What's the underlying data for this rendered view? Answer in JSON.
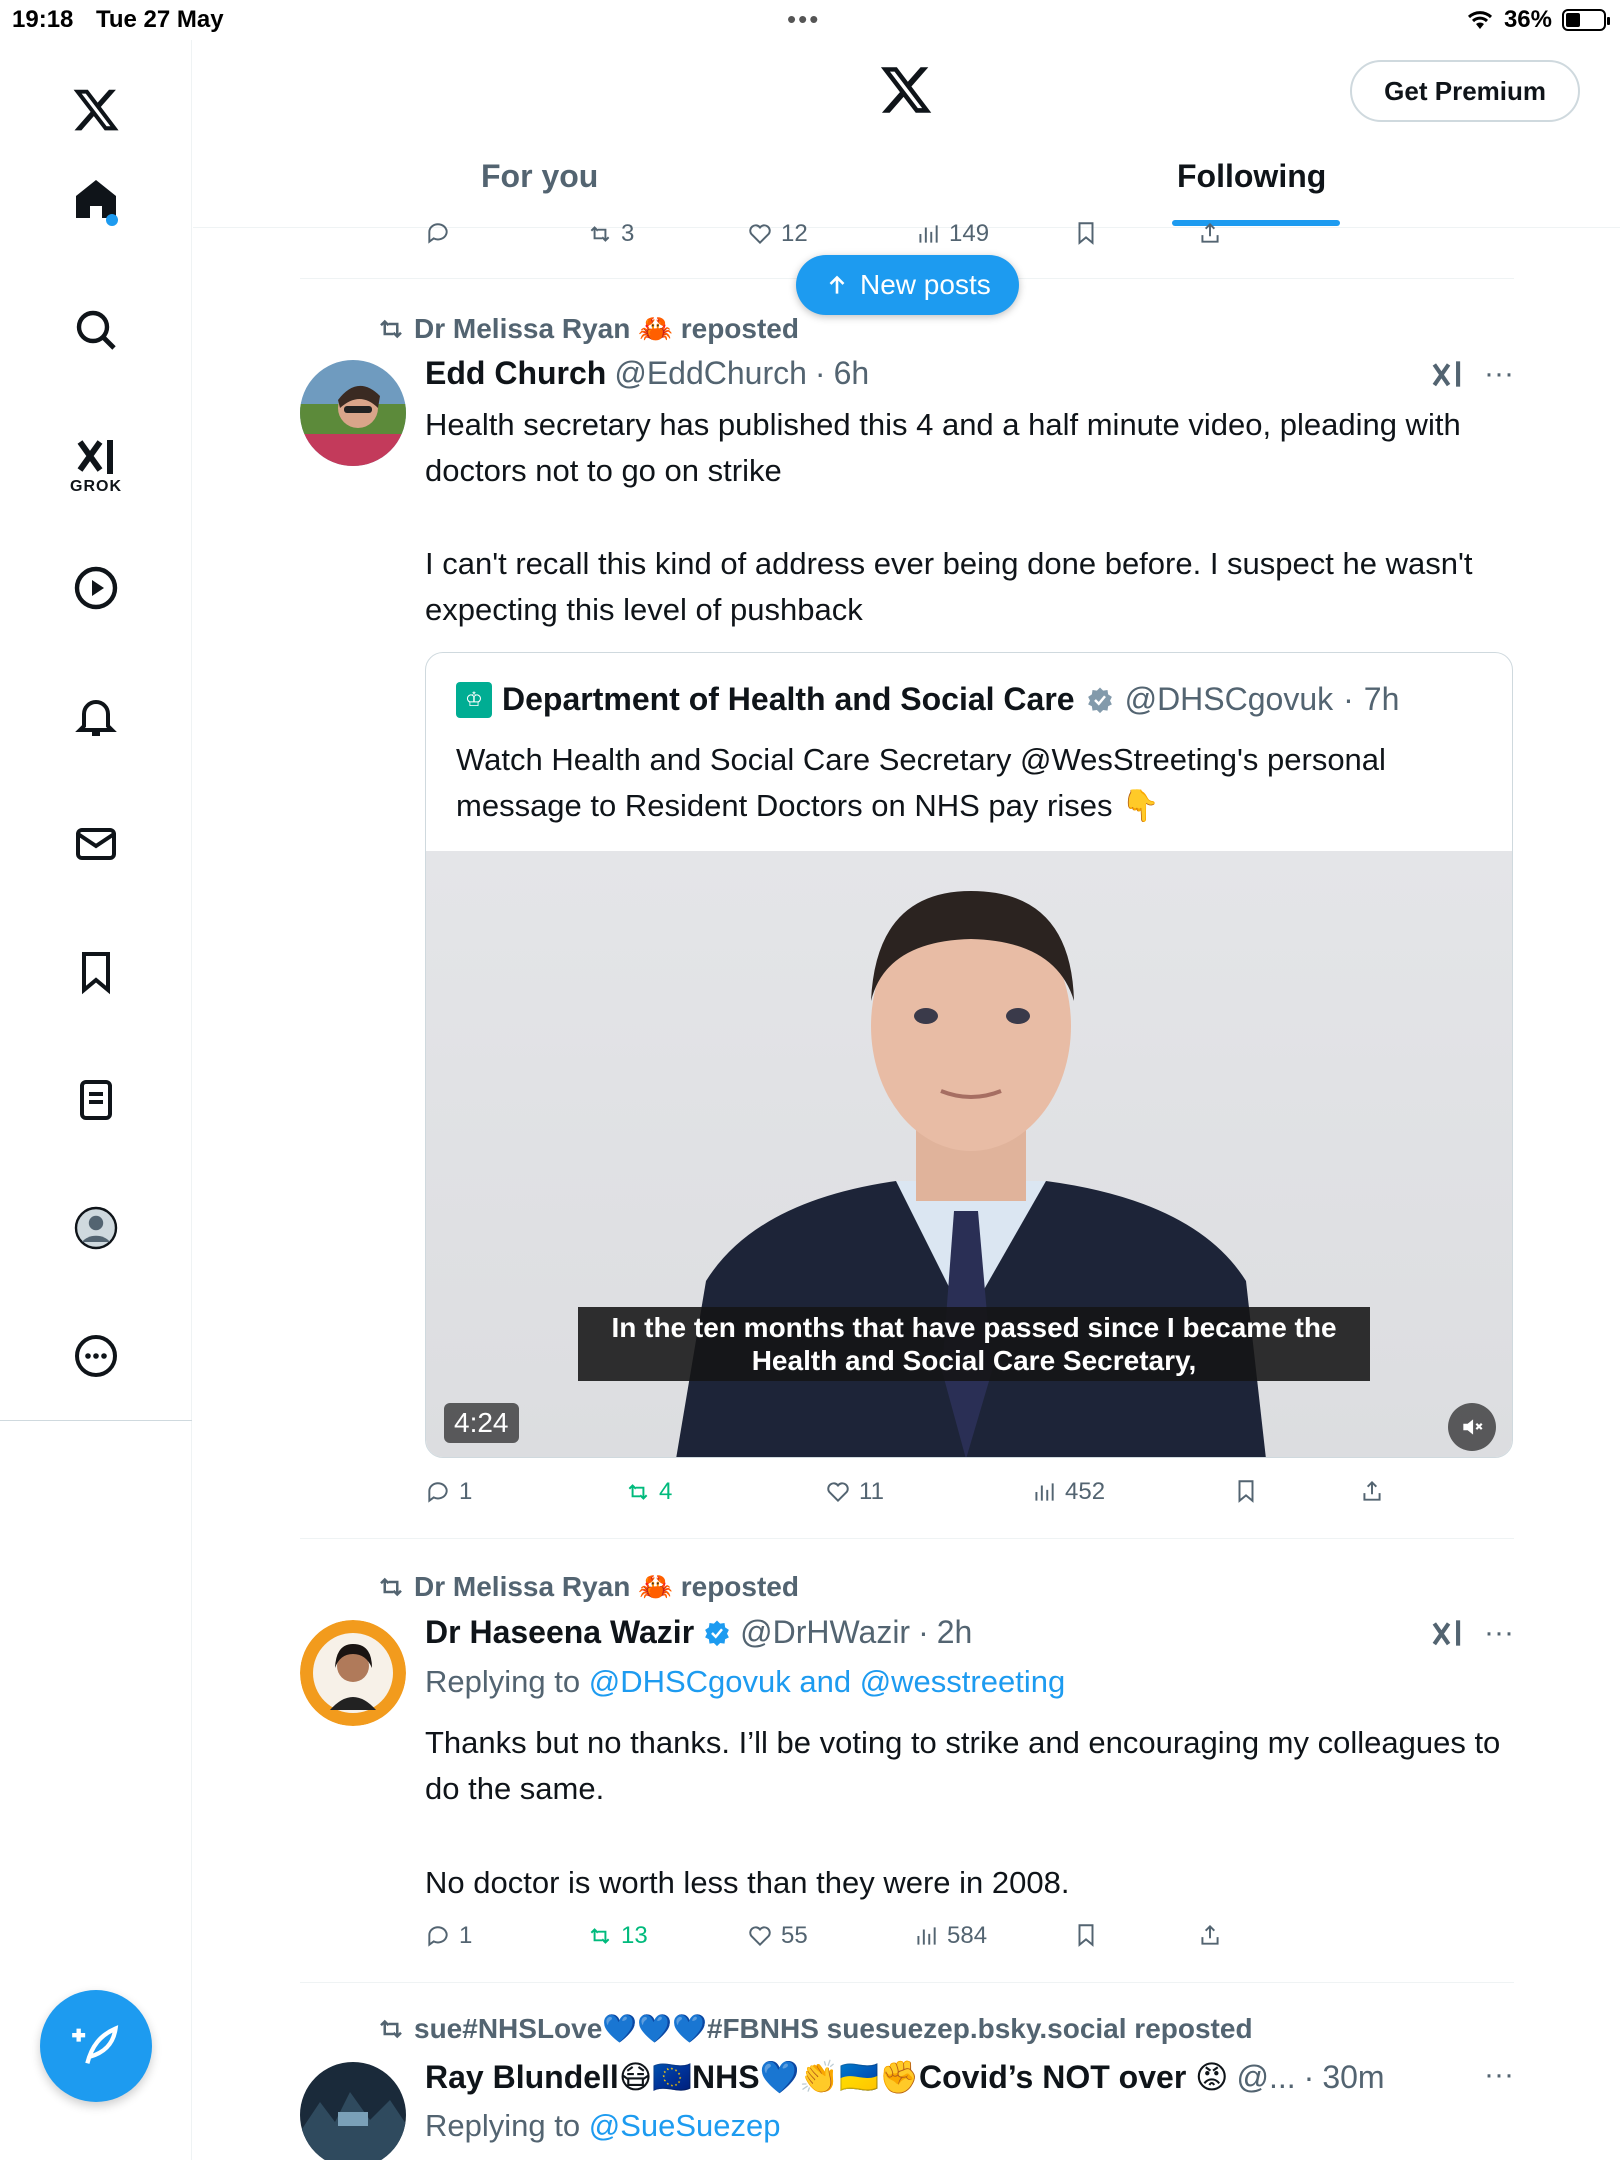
{
  "status_bar": {
    "time": "19:18",
    "date": "Tue 27 May",
    "battery": "36%"
  },
  "header": {
    "premium_button": "Get Premium",
    "tabs": [
      "For you",
      "Following"
    ],
    "active_tab": "Following"
  },
  "rail": {
    "grok_label": "GROK"
  },
  "new_posts_label": "New posts",
  "partial_post": {
    "retweets": "3",
    "likes": "12",
    "views": "149"
  },
  "posts": [
    {
      "repost_by": "Dr Melissa Ryan 🦀 reposted",
      "name": "Edd Church",
      "handle": "@EddChurch",
      "time": "6h",
      "text1": "Health secretary has published this 4 and a half minute video, pleading with doctors not to go on strike",
      "text2": "I can't recall this kind of address ever being done before. I suspect he wasn't expecting this level of pushback",
      "quote": {
        "name": "Department of Health and Social Care",
        "handle": "@DHSCgovuk",
        "time": "7h",
        "text": "Watch Health and Social Care Secretary @WesStreeting's personal message to Resident Doctors on NHS pay rises 👇",
        "caption": "In the ten months that have passed since I became the Health and Social Care Secretary,",
        "duration": "4:24"
      },
      "replies": "1",
      "retweets": "4",
      "likes": "11",
      "views": "452"
    },
    {
      "repost_by": "Dr Melissa Ryan 🦀 reposted",
      "name": "Dr Haseena Wazir",
      "handle": "@DrHWazir",
      "time": "2h",
      "replying_prefix": "Replying to",
      "replying_to": "@DHSCgovuk and @wesstreeting",
      "text1": "Thanks but no thanks. I’ll be voting to strike and encouraging my colleagues to do the same.",
      "text2": "No doctor is worth less than they were in 2008.",
      "replies": "1",
      "retweets": "13",
      "likes": "55",
      "views": "584"
    },
    {
      "repost_by": "sue#NHSLove💙💙💙#FBNHS suesuezep.bsky.social reposted",
      "name": "Ray Blundell😷🇪🇺NHS💙👏🇺🇦✊Covid’s NOT over 😡",
      "handle": "@...",
      "time": "30m",
      "replying_prefix": "Replying to",
      "replying_to": "@SueSuezep"
    }
  ],
  "colors": {
    "accent": "#1d9bf0",
    "retweet_green": "#00ba7c",
    "secondary_text": "#536471"
  }
}
